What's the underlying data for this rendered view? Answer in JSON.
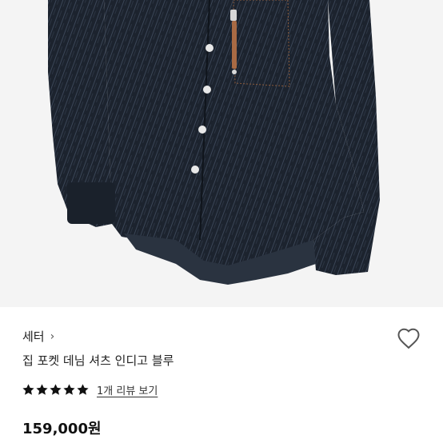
{
  "product": {
    "brand": "세터",
    "brand_chevron": "›",
    "name": "집 포켓 데님 셔츠 인디고 블루",
    "rating_stars": 5,
    "rating_max": 5,
    "review_link": "1개 리뷰 보기",
    "price": "159,000원"
  },
  "icons": {
    "heart": "heart-outline-icon",
    "star": "star-filled-icon"
  },
  "colors": {
    "denim": "#1c232e",
    "star": "#111111",
    "heart_stroke": "#555555"
  }
}
